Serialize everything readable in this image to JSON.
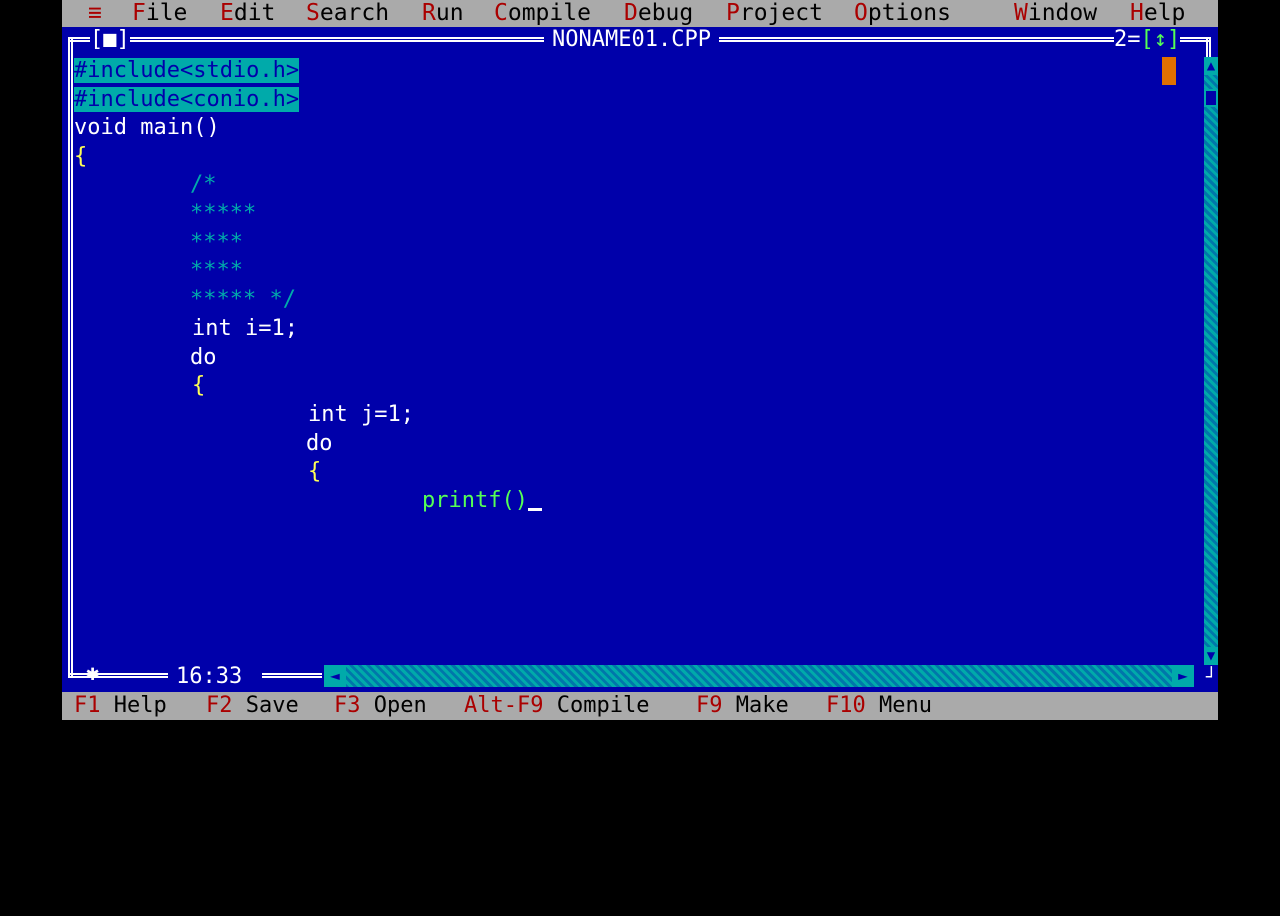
{
  "menu": {
    "system": "≡",
    "items": [
      {
        "hot": "F",
        "rest": "ile"
      },
      {
        "hot": "E",
        "rest": "dit"
      },
      {
        "hot": "S",
        "rest": "earch"
      },
      {
        "hot": "R",
        "rest": "un"
      },
      {
        "hot": "C",
        "rest": "ompile"
      },
      {
        "hot": "D",
        "rest": "ebug"
      },
      {
        "hot": "P",
        "rest": "roject"
      },
      {
        "hot": "O",
        "rest": "ptions"
      },
      {
        "hot": "W",
        "rest": "indow"
      },
      {
        "hot": "H",
        "rest": "elp"
      }
    ]
  },
  "window": {
    "close_box": "[■]",
    "title": "NONAME01.CPP",
    "number": "2",
    "zoom_box": "[↕]",
    "cursor_position": "16:33"
  },
  "code": {
    "lines": [
      "#include<stdio.h>",
      "#include<conio.h>",
      "void main()",
      "{",
      "/*",
      "*****",
      "****",
      "****",
      "***** */",
      "int i=1;",
      "do",
      "{",
      "int j=1;",
      "do",
      "{",
      "printf()"
    ]
  },
  "statusbar": {
    "items": [
      {
        "key": "F1",
        "label": " Help"
      },
      {
        "key": "F2",
        "label": " Save"
      },
      {
        "key": "F3",
        "label": " Open"
      },
      {
        "key": "Alt-F9",
        "label": " Compile"
      },
      {
        "key": "F9",
        "label": " Make"
      },
      {
        "key": "F10",
        "label": " Menu"
      }
    ]
  },
  "colors": {
    "editor_bg": "#0000aa",
    "menu_bg": "#aaaaaa",
    "hotkey": "#aa0000",
    "selection": "#00aaaa"
  }
}
